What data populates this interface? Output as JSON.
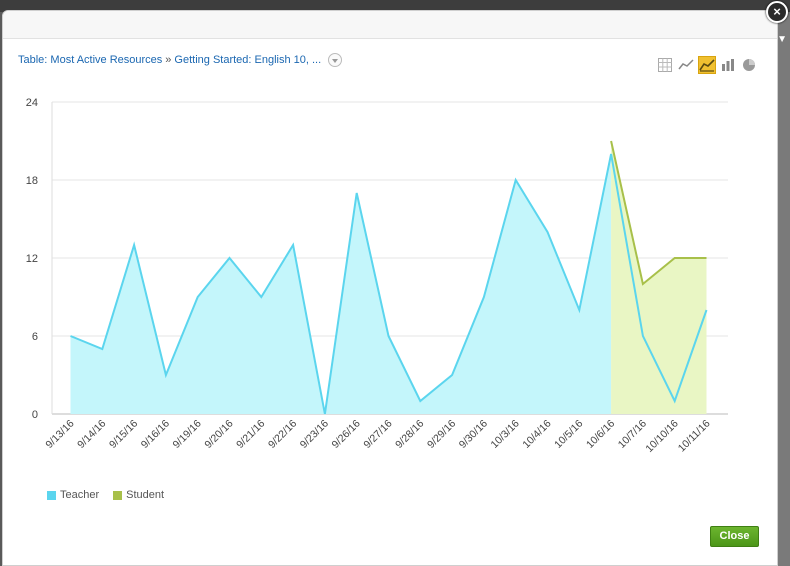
{
  "window": {
    "close_glyph": "×"
  },
  "breadcrumb": {
    "item1": "Table: Most Active Resources",
    "separator": "»",
    "item2": "Getting Started: English 10, ..."
  },
  "toolbar": {
    "icons": [
      "table-icon",
      "line-chart-icon",
      "area-chart-icon",
      "bar-chart-icon",
      "pie-chart-icon"
    ],
    "active": "area-chart-icon"
  },
  "colors": {
    "teacher_line": "#5bd5ee",
    "teacher_fill": "#c4f6fb",
    "student_line": "#a8c04a",
    "student_fill": "#e9f6c4",
    "accent_active": "#f0c030",
    "close_button": "#5aa523"
  },
  "chart_data": {
    "type": "area",
    "categories": [
      "9/13/16",
      "9/14/16",
      "9/15/16",
      "9/16/16",
      "9/19/16",
      "9/20/16",
      "9/21/16",
      "9/22/16",
      "9/23/16",
      "9/26/16",
      "9/27/16",
      "9/28/16",
      "9/29/16",
      "9/30/16",
      "10/3/16",
      "10/4/16",
      "10/5/16",
      "10/6/16",
      "10/7/16",
      "10/10/16",
      "10/11/16"
    ],
    "series": [
      {
        "name": "Teacher",
        "values": [
          6,
          5,
          13,
          3,
          9,
          12,
          9,
          13,
          0,
          17,
          6,
          1,
          3,
          9,
          18,
          14,
          8,
          20,
          6,
          1,
          8
        ]
      },
      {
        "name": "Student",
        "values": [
          null,
          null,
          null,
          null,
          null,
          null,
          null,
          null,
          null,
          null,
          null,
          null,
          null,
          null,
          null,
          null,
          null,
          21,
          10,
          12,
          12
        ]
      }
    ],
    "yticks": [
      "0",
      "6",
      "12",
      "18",
      "24"
    ],
    "ylim": [
      0,
      24
    ],
    "grid": true,
    "legend_position": "bottom-left"
  },
  "legend": {
    "teacher": "Teacher",
    "student": "Student"
  },
  "footer": {
    "close_label": "Close"
  }
}
